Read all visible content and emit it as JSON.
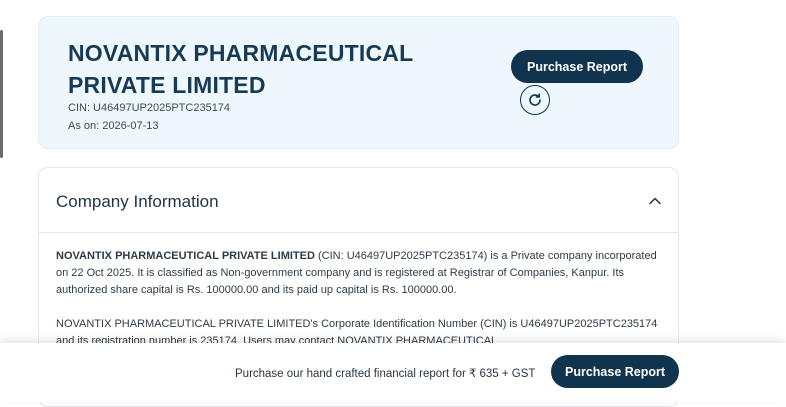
{
  "company": {
    "name": "NOVANTIX PHARMACEUTICAL PRIVATE LIMITED",
    "cin_line": "CIN: U46497UP2025PTC235174",
    "as_on_line": "As on: 2026-07-13"
  },
  "header_actions": {
    "purchase_label": "Purchase Report",
    "refresh_icon": "refresh-icon"
  },
  "company_info": {
    "title": "Company Information",
    "toggle_icon": "chevron-up-icon",
    "para1_name": "NOVANTIX PHARMACEUTICAL PRIVATE LIMITED",
    "para1_text": " (CIN: U46497UP2025PTC235174) is a Private company incorporated on 22 Oct 2025. It is classified as Non-government company and is registered at Registrar of Companies, Kanpur. Its authorized share capital is Rs. 100000.00 and its paid up capital is Rs. 100000.00.",
    "para2_text": "NOVANTIX PHARMACEUTICAL PRIVATE LIMITED's Corporate Identification Number (CIN) is U46497UP2025PTC235174 and its registration number is 235174. Users may contact NOVANTIX PHARMACEUTICAL"
  },
  "bottom_bar": {
    "text": "Purchase our hand crafted financial report for ₹ 635 + GST",
    "purchase_label": "Purchase Report"
  },
  "colors": {
    "brand_navy": "#10344d",
    "header_bg": "#eef7fb"
  }
}
